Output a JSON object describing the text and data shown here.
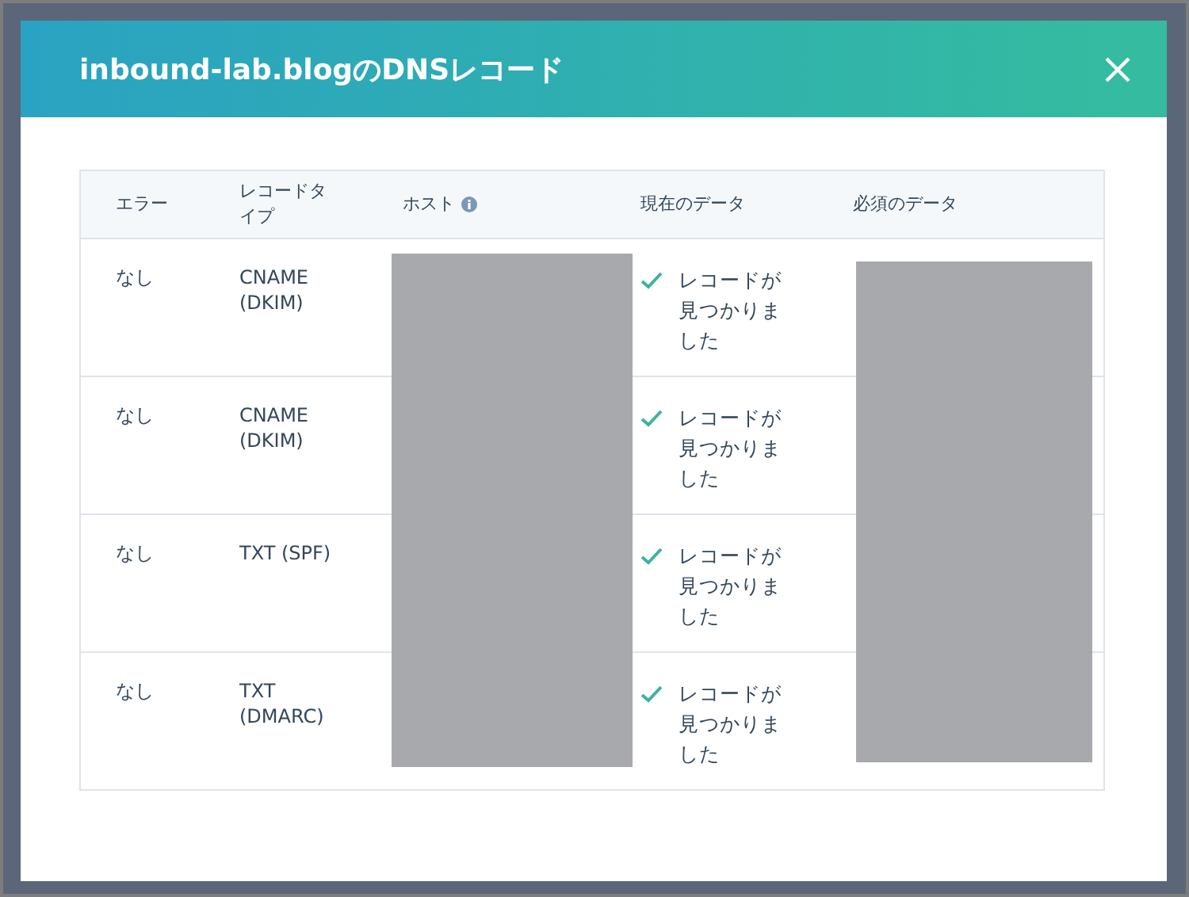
{
  "dialog": {
    "title": "inbound-lab.blogのDNSレコード"
  },
  "table": {
    "columns": [
      "エラー",
      "レコードタイプ",
      "ホスト",
      "現在のデータ",
      "必須のデータ"
    ],
    "rows": [
      {
        "error": "なし",
        "type": "CNAME (DKIM)",
        "status": "レコードが見つかりました"
      },
      {
        "error": "なし",
        "type": "CNAME (DKIM)",
        "status": "レコードが見つかりました"
      },
      {
        "error": "なし",
        "type": "TXT (SPF)",
        "status": "レコードが見つかりました"
      },
      {
        "error": "なし",
        "type": "TXT (DMARC)",
        "status": "レコードが見つかりました"
      }
    ]
  }
}
